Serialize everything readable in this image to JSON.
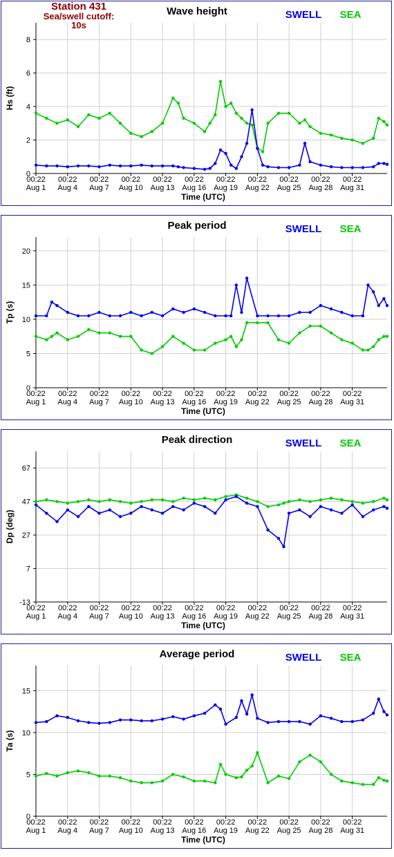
{
  "station": {
    "title": "Station 431",
    "subtitle": "Sea/swell cutoff: 10s"
  },
  "colors": {
    "swell": "#0000ee",
    "sea": "#00cc00",
    "border": "#1c1c9c",
    "grid": "#d0d0d0",
    "station_text": "#8b0000"
  },
  "legend": {
    "swell": "SWELL",
    "sea": "SEA"
  },
  "x_axis": {
    "label": "Time (UTC)",
    "tick_time": "00:22",
    "tick_dates": [
      "Aug 1",
      "Aug 4",
      "Aug 7",
      "Aug 10",
      "Aug 13",
      "Aug 16",
      "Aug 19",
      "Aug 22",
      "Aug 25",
      "Aug 28",
      "Aug 31"
    ],
    "xlim_days": [
      0,
      33.3
    ]
  },
  "chart_data": [
    {
      "id": "wave-height",
      "type": "line",
      "title": "Wave height",
      "ylabel": "Hs (ft)",
      "ylim": [
        0,
        9
      ],
      "yticks": [
        0,
        2,
        4,
        6,
        8
      ],
      "x": [
        0,
        1,
        2,
        3,
        4,
        5,
        6,
        7,
        8,
        9,
        10,
        11,
        12,
        13,
        13.5,
        14,
        15,
        16,
        16.5,
        17,
        17.5,
        18,
        18.5,
        19,
        19.5,
        20,
        20.5,
        21,
        21.5,
        22,
        23,
        24,
        25,
        25.5,
        26,
        27,
        28,
        29,
        30,
        31,
        32,
        32.5,
        33,
        33.3
      ],
      "series": [
        {
          "name": "SWELL",
          "values": [
            0.5,
            0.45,
            0.45,
            0.4,
            0.45,
            0.45,
            0.4,
            0.5,
            0.45,
            0.45,
            0.5,
            0.45,
            0.45,
            0.45,
            0.4,
            0.35,
            0.3,
            0.25,
            0.3,
            0.6,
            1.4,
            1.2,
            0.5,
            0.3,
            1.0,
            1.8,
            3.8,
            1.5,
            0.5,
            0.4,
            0.35,
            0.35,
            0.5,
            1.8,
            0.7,
            0.5,
            0.4,
            0.35,
            0.35,
            0.35,
            0.4,
            0.6,
            0.6,
            0.55
          ]
        },
        {
          "name": "SEA",
          "values": [
            3.6,
            3.3,
            3.0,
            3.2,
            2.8,
            3.5,
            3.3,
            3.6,
            3.0,
            2.4,
            2.2,
            2.5,
            3.0,
            4.5,
            4.2,
            3.3,
            3.0,
            2.5,
            3.0,
            3.5,
            5.5,
            4.0,
            4.2,
            3.6,
            3.3,
            3.0,
            2.9,
            1.5,
            1.3,
            3.0,
            3.6,
            3.6,
            3.0,
            3.2,
            2.8,
            2.4,
            2.3,
            2.1,
            2.0,
            1.8,
            2.1,
            3.3,
            3.1,
            2.9
          ]
        }
      ]
    },
    {
      "id": "peak-period",
      "type": "line",
      "title": "Peak period",
      "ylabel": "Tp (s)",
      "ylim": [
        0,
        22
      ],
      "yticks": [
        0,
        5,
        10,
        15,
        20
      ],
      "x": [
        0,
        1,
        1.5,
        2,
        3,
        4,
        5,
        6,
        7,
        8,
        9,
        10,
        11,
        12,
        13,
        14,
        15,
        16,
        17,
        18,
        18.5,
        19,
        19.5,
        20,
        21,
        22,
        23,
        24,
        25,
        26,
        27,
        28,
        29,
        30,
        31,
        31.5,
        32,
        32.5,
        33,
        33.3
      ],
      "series": [
        {
          "name": "SWELL",
          "values": [
            10.5,
            10.5,
            12.5,
            12.0,
            11.0,
            10.5,
            10.5,
            11.0,
            10.5,
            10.5,
            11.0,
            10.5,
            11.0,
            10.5,
            11.5,
            11.0,
            11.5,
            11.0,
            10.5,
            10.5,
            10.5,
            15.0,
            11.0,
            16.0,
            10.5,
            10.5,
            10.5,
            10.5,
            11.0,
            11.0,
            12.0,
            11.5,
            11.0,
            10.5,
            10.5,
            15.0,
            14.0,
            12.0,
            13.0,
            12.0
          ]
        },
        {
          "name": "SEA",
          "values": [
            7.5,
            7.0,
            7.5,
            8.0,
            7.0,
            7.5,
            8.5,
            8.0,
            8.0,
            7.5,
            7.5,
            5.5,
            5.0,
            6.0,
            7.5,
            6.5,
            5.5,
            5.5,
            6.5,
            7.0,
            7.5,
            6.0,
            7.0,
            9.5,
            9.5,
            9.5,
            7.0,
            6.5,
            8.0,
            9.0,
            9.0,
            8.0,
            7.0,
            6.5,
            5.5,
            5.5,
            6.0,
            7.0,
            7.5,
            7.5
          ]
        }
      ]
    },
    {
      "id": "peak-direction",
      "type": "line",
      "title": "Peak direction",
      "ylabel": "Dp (deg)",
      "ylim": [
        -13,
        77
      ],
      "yticks": [
        -13,
        7,
        27,
        47,
        67
      ],
      "x": [
        0,
        1,
        2,
        3,
        4,
        5,
        6,
        7,
        8,
        9,
        10,
        11,
        12,
        13,
        14,
        15,
        16,
        17,
        18,
        19,
        20,
        21,
        22,
        23,
        23.5,
        24,
        25,
        26,
        27,
        28,
        29,
        30,
        31,
        32,
        33,
        33.3
      ],
      "series": [
        {
          "name": "SWELL",
          "values": [
            45,
            40,
            35,
            42,
            38,
            44,
            40,
            42,
            38,
            40,
            44,
            42,
            40,
            44,
            42,
            46,
            44,
            40,
            48,
            50,
            46,
            44,
            30,
            25,
            20,
            40,
            42,
            38,
            44,
            42,
            40,
            45,
            38,
            42,
            44,
            43
          ]
        },
        {
          "name": "SEA",
          "values": [
            47,
            48,
            47,
            46,
            47,
            48,
            47,
            48,
            47,
            46,
            47,
            48,
            48,
            47,
            49,
            48,
            49,
            48,
            50,
            51,
            49,
            47,
            44,
            45,
            46,
            47,
            48,
            47,
            48,
            49,
            48,
            47,
            46,
            47,
            49,
            48
          ]
        }
      ]
    },
    {
      "id": "average-period",
      "type": "line",
      "title": "Average period",
      "ylabel": "Ta (s)",
      "ylim": [
        0,
        18
      ],
      "yticks": [
        0,
        5,
        10,
        15
      ],
      "x": [
        0,
        1,
        2,
        3,
        4,
        5,
        6,
        7,
        8,
        9,
        10,
        11,
        12,
        13,
        14,
        15,
        16,
        17,
        17.5,
        18,
        19,
        19.5,
        20,
        20.5,
        21,
        22,
        23,
        24,
        25,
        26,
        27,
        28,
        29,
        30,
        31,
        32,
        32.5,
        33,
        33.3
      ],
      "series": [
        {
          "name": "SWELL",
          "values": [
            11.2,
            11.3,
            12.0,
            11.8,
            11.4,
            11.2,
            11.1,
            11.2,
            11.5,
            11.5,
            11.4,
            11.4,
            11.6,
            11.9,
            11.6,
            12.0,
            12.3,
            13.3,
            12.8,
            11.0,
            11.8,
            13.8,
            12.2,
            14.5,
            11.7,
            11.2,
            11.3,
            11.3,
            11.3,
            11.0,
            12.0,
            11.7,
            11.3,
            11.3,
            11.5,
            12.3,
            14.0,
            12.5,
            12.1
          ]
        },
        {
          "name": "SEA",
          "values": [
            4.8,
            5.1,
            4.8,
            5.2,
            5.4,
            5.2,
            4.8,
            4.8,
            4.6,
            4.2,
            4.0,
            4.0,
            4.2,
            5.0,
            4.7,
            4.2,
            4.2,
            4.0,
            6.2,
            5.0,
            4.6,
            4.7,
            5.5,
            6.0,
            7.6,
            4.0,
            4.8,
            4.5,
            6.5,
            7.3,
            6.5,
            5.0,
            4.2,
            4.0,
            3.8,
            3.8,
            4.6,
            4.3,
            4.2
          ]
        }
      ]
    }
  ]
}
